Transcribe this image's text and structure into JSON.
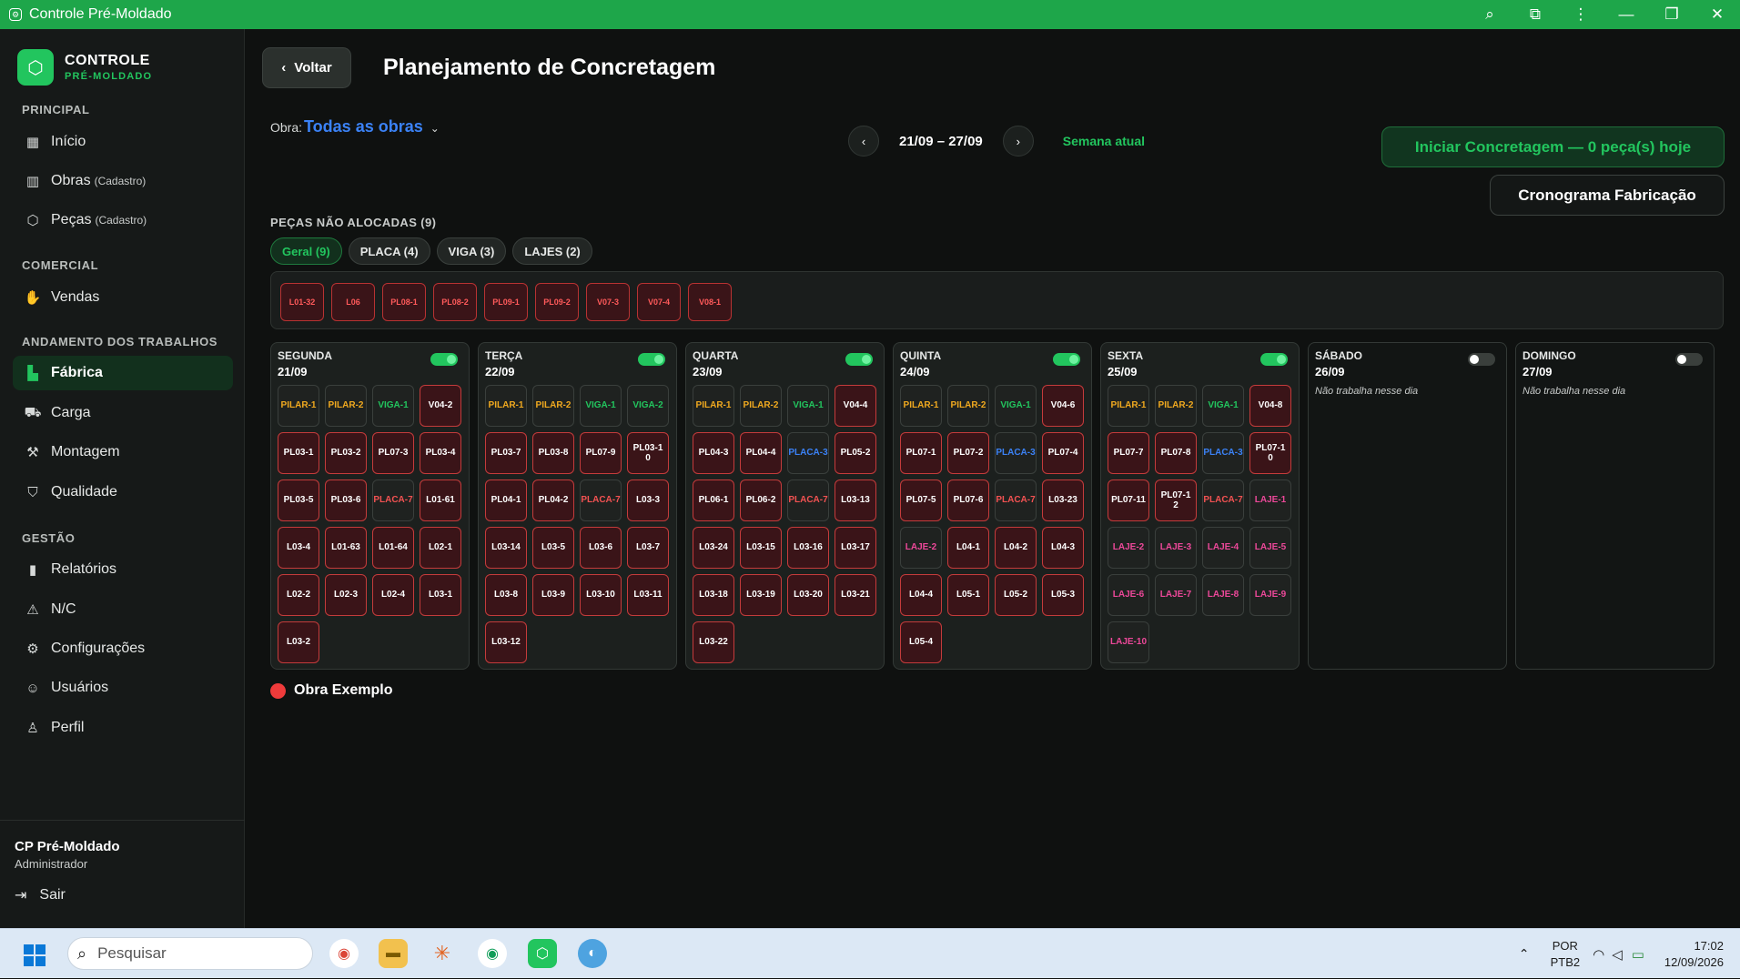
{
  "window": {
    "title": "Controle Pré-Moldado",
    "app_icon": "settings-icon"
  },
  "brand": {
    "line1": "CONTROLE",
    "line2": "PRÉ-MOLDADO"
  },
  "sidebar": {
    "sections": {
      "principal": "PRINCIPAL",
      "comercial": "COMERCIAL",
      "andamento": "ANDAMENTO DOS TRABALHOS",
      "gestao": "GESTÃO"
    },
    "items": {
      "inicio": "Início",
      "obras": "Obras",
      "obras_sub": "(Cadastro)",
      "pecas": "Peças",
      "pecas_sub": "(Cadastro)",
      "vendas": "Vendas",
      "fabrica": "Fábrica",
      "carga": "Carga",
      "montagem": "Montagem",
      "qualidade": "Qualidade",
      "relatorios": "Relatórios",
      "nc": "N/C",
      "configuracoes": "Configurações",
      "usuarios": "Usuários",
      "perfil": "Perfil"
    },
    "user": {
      "name": "CP Pré-Moldado",
      "role": "Administrador",
      "logout": "Sair"
    }
  },
  "header": {
    "back": "Voltar",
    "title": "Planejamento de Concretagem",
    "obra_label": "Obra:",
    "obra_value": "Todas as obras",
    "week_range": "21/09 – 27/09",
    "week_current": "Semana atual",
    "start_button": "Iniciar Concretagem — 0 peça(s) hoje",
    "schedule_button": "Cronograma Fabricação"
  },
  "unallocated": {
    "title": "PEÇAS NÃO ALOCADAS (9)",
    "filters": [
      "Geral (9)",
      "PLACA (4)",
      "VIGA (3)",
      "LAJES (2)"
    ],
    "pieces": [
      "L01-32",
      "L06",
      "PL08-1",
      "PL08-2",
      "PL09-1",
      "PL09-2",
      "V07-3",
      "V07-4",
      "V08-1"
    ]
  },
  "days": [
    {
      "name": "SEGUNDA",
      "date": "21/09",
      "active": true,
      "note": "",
      "pieces": [
        [
          "PILAR-1",
          "pilar"
        ],
        [
          "PILAR-2",
          "pilar"
        ],
        [
          "VIGA-1",
          "viga"
        ],
        [
          "V04-2",
          "red"
        ],
        [
          "PL03-1",
          "red"
        ],
        [
          "PL03-2",
          "red"
        ],
        [
          "PL07-3",
          "red"
        ],
        [
          "PL03-4",
          "red"
        ],
        [
          "PL03-5",
          "red"
        ],
        [
          "PL03-6",
          "red"
        ],
        [
          "PLACA-7",
          "placa"
        ],
        [
          "L01-61",
          "red"
        ],
        [
          "L03-4",
          "red"
        ],
        [
          "L01-63",
          "red"
        ],
        [
          "L01-64",
          "red"
        ],
        [
          "L02-1",
          "red"
        ],
        [
          "L02-2",
          "red"
        ],
        [
          "L02-3",
          "red"
        ],
        [
          "L02-4",
          "red"
        ],
        [
          "L03-1",
          "red"
        ],
        [
          "L03-2",
          "red"
        ]
      ]
    },
    {
      "name": "TERÇA",
      "date": "22/09",
      "active": true,
      "note": "",
      "pieces": [
        [
          "PILAR-1",
          "pilar"
        ],
        [
          "PILAR-2",
          "pilar"
        ],
        [
          "VIGA-1",
          "viga"
        ],
        [
          "VIGA-2",
          "viga"
        ],
        [
          "PL03-7",
          "red"
        ],
        [
          "PL03-8",
          "red"
        ],
        [
          "PL07-9",
          "red"
        ],
        [
          "PL03-10",
          "red"
        ],
        [
          "PL04-1",
          "red"
        ],
        [
          "PL04-2",
          "red"
        ],
        [
          "PLACA-7",
          "placa"
        ],
        [
          "L03-3",
          "red"
        ],
        [
          "L03-14",
          "red"
        ],
        [
          "L03-5",
          "red"
        ],
        [
          "L03-6",
          "red"
        ],
        [
          "L03-7",
          "red"
        ],
        [
          "L03-8",
          "red"
        ],
        [
          "L03-9",
          "red"
        ],
        [
          "L03-10",
          "red"
        ],
        [
          "L03-11",
          "red"
        ],
        [
          "L03-12",
          "red"
        ]
      ]
    },
    {
      "name": "QUARTA",
      "date": "23/09",
      "active": true,
      "note": "",
      "pieces": [
        [
          "PILAR-1",
          "pilar"
        ],
        [
          "PILAR-2",
          "pilar"
        ],
        [
          "VIGA-1",
          "viga"
        ],
        [
          "V04-4",
          "red"
        ],
        [
          "PL04-3",
          "red"
        ],
        [
          "PL04-4",
          "red"
        ],
        [
          "PLACA-3",
          "placab"
        ],
        [
          "PL05-2",
          "red"
        ],
        [
          "PL06-1",
          "red"
        ],
        [
          "PL06-2",
          "red"
        ],
        [
          "PLACA-7",
          "placa"
        ],
        [
          "L03-13",
          "red"
        ],
        [
          "L03-24",
          "red"
        ],
        [
          "L03-15",
          "red"
        ],
        [
          "L03-16",
          "red"
        ],
        [
          "L03-17",
          "red"
        ],
        [
          "L03-18",
          "red"
        ],
        [
          "L03-19",
          "red"
        ],
        [
          "L03-20",
          "red"
        ],
        [
          "L03-21",
          "red"
        ],
        [
          "L03-22",
          "red"
        ]
      ]
    },
    {
      "name": "QUINTA",
      "date": "24/09",
      "active": true,
      "note": "",
      "pieces": [
        [
          "PILAR-1",
          "pilar"
        ],
        [
          "PILAR-2",
          "pilar"
        ],
        [
          "VIGA-1",
          "viga"
        ],
        [
          "V04-6",
          "red"
        ],
        [
          "PL07-1",
          "red"
        ],
        [
          "PL07-2",
          "red"
        ],
        [
          "PLACA-3",
          "placab"
        ],
        [
          "PL07-4",
          "red"
        ],
        [
          "PL07-5",
          "red"
        ],
        [
          "PL07-6",
          "red"
        ],
        [
          "PLACA-7",
          "placa"
        ],
        [
          "L03-23",
          "red"
        ],
        [
          "LAJE-2",
          "laje"
        ],
        [
          "L04-1",
          "red"
        ],
        [
          "L04-2",
          "red"
        ],
        [
          "L04-3",
          "red"
        ],
        [
          "L04-4",
          "red"
        ],
        [
          "L05-1",
          "red"
        ],
        [
          "L05-2",
          "red"
        ],
        [
          "L05-3",
          "red"
        ],
        [
          "L05-4",
          "red"
        ]
      ]
    },
    {
      "name": "SEXTA",
      "date": "25/09",
      "active": true,
      "note": "",
      "pieces": [
        [
          "PILAR-1",
          "pilar"
        ],
        [
          "PILAR-2",
          "pilar"
        ],
        [
          "VIGA-1",
          "viga"
        ],
        [
          "V04-8",
          "red"
        ],
        [
          "PL07-7",
          "red"
        ],
        [
          "PL07-8",
          "red"
        ],
        [
          "PLACA-3",
          "placab"
        ],
        [
          "PL07-10",
          "red"
        ],
        [
          "PL07-11",
          "red"
        ],
        [
          "PL07-12",
          "red"
        ],
        [
          "PLACA-7",
          "placa"
        ],
        [
          "LAJE-1",
          "laje"
        ],
        [
          "LAJE-2",
          "laje"
        ],
        [
          "LAJE-3",
          "laje"
        ],
        [
          "LAJE-4",
          "laje"
        ],
        [
          "LAJE-5",
          "laje"
        ],
        [
          "LAJE-6",
          "laje"
        ],
        [
          "LAJE-7",
          "laje"
        ],
        [
          "LAJE-8",
          "laje"
        ],
        [
          "LAJE-9",
          "laje"
        ],
        [
          "LAJE-10",
          "laje"
        ]
      ]
    },
    {
      "name": "SÁBADO",
      "date": "26/09",
      "active": false,
      "note": "Não trabalha nesse dia",
      "pieces": []
    },
    {
      "name": "DOMINGO",
      "date": "27/09",
      "active": false,
      "note": "Não trabalha nesse dia",
      "pieces": []
    }
  ],
  "legend": {
    "label": "Obra Exemplo",
    "color": "#ef3b3b"
  },
  "colors": {
    "accent": "#22c55e",
    "link": "#3b82f6",
    "titlebar": "#1ea64a",
    "piece_border": "#c43b3b"
  },
  "taskbar": {
    "search_placeholder": "Pesquisar",
    "lang1": "POR",
    "lang2": "PTB2",
    "time": "17:02",
    "date": "12/09/2026"
  }
}
